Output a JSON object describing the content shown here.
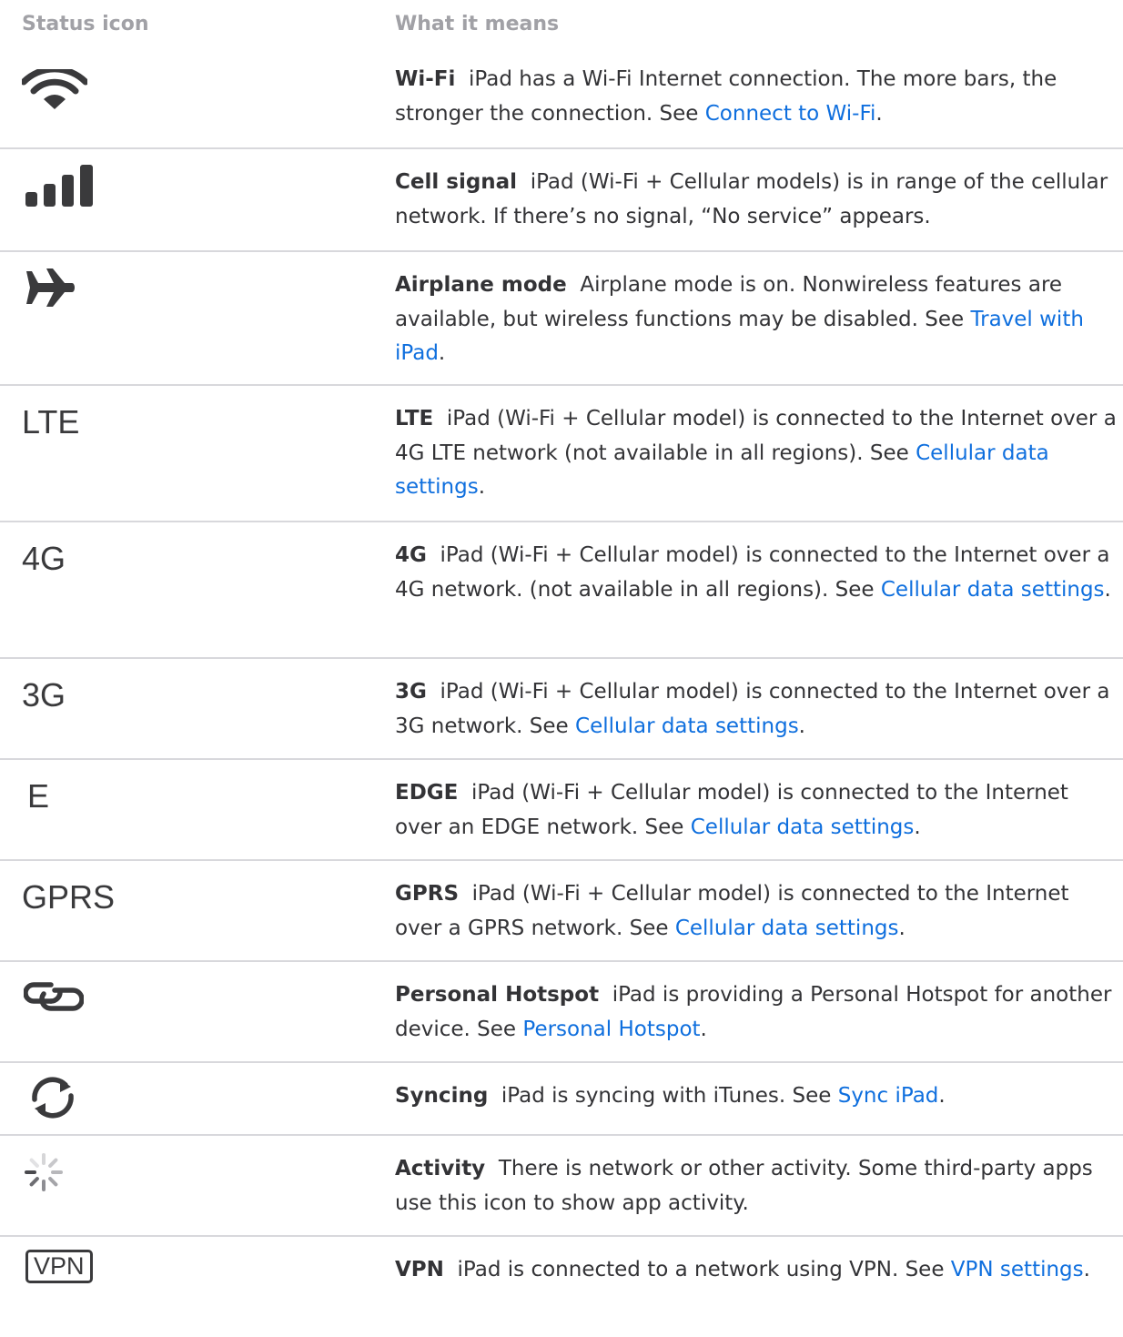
{
  "header": {
    "col_icon": "Status icon",
    "col_meaning": "What it means"
  },
  "rows": [
    {
      "icon": "wifi-icon",
      "title": "Wi-Fi",
      "text": "iPad has a Wi-Fi Internet connection. The more bars, the stronger the connection. See ",
      "link": "Connect to Wi-Fi",
      "after": "."
    },
    {
      "icon": "cell-signal-icon",
      "title": "Cell signal",
      "text": "iPad (Wi-Fi + Cellular models) is in range of the cellular network. If there’s no signal, “No service” appears.",
      "link": "",
      "after": ""
    },
    {
      "icon": "airplane-icon",
      "title": "Airplane mode",
      "text": "Airplane mode is on. Nonwireless features are available, but wireless functions may be disabled. See ",
      "link": "Travel with iPad",
      "after": "."
    },
    {
      "icon_text": "LTE",
      "title": "LTE",
      "text": "iPad (Wi-Fi + Cellular model) is connected to the Internet over a 4G LTE network (not available in all regions). See ",
      "link": "Cellular data settings",
      "after": "."
    },
    {
      "icon_text": "4G",
      "title": "4G",
      "text": "iPad (Wi-Fi + Cellular model) is connected to the Internet over a 4G network. (not available in all regions). See ",
      "link": "Cellular data settings",
      "after": "."
    },
    {
      "icon_text": "3G",
      "title": "3G",
      "text": "iPad (Wi-Fi + Cellular model) is connected to the Internet over a 3G network. See ",
      "link": "Cellular data settings",
      "after": "."
    },
    {
      "icon_text": "E",
      "title": "EDGE",
      "text": "iPad (Wi-Fi + Cellular model) is connected to the Internet over an EDGE network. See ",
      "link": "Cellular data settings",
      "after": "."
    },
    {
      "icon_text": "GPRS",
      "title": "GPRS",
      "text": "iPad (Wi-Fi + Cellular model) is connected to the Internet over a GPRS network. See ",
      "link": "Cellular data settings",
      "after": "."
    },
    {
      "icon": "personal-hotspot-icon",
      "title": "Personal Hotspot",
      "text": "iPad is providing a Personal Hotspot for another device. See ",
      "link": "Personal Hotspot",
      "after": "."
    },
    {
      "icon": "syncing-icon",
      "title": "Syncing",
      "text": "iPad is syncing with iTunes. See ",
      "link": "Sync iPad",
      "after": "."
    },
    {
      "icon": "activity-icon",
      "title": "Activity",
      "text": "There is network or other activity. Some third-party apps use this icon to show app activity.",
      "link": "",
      "after": ""
    },
    {
      "icon_text": "VPN",
      "title": "VPN",
      "text": "iPad is connected to a network using VPN. See ",
      "link": "VPN settings",
      "after": "."
    }
  ],
  "colors": {
    "link": "#0f6fde",
    "header_text": "#a1a1a6",
    "body_text": "#333336",
    "icon": "#3a3a3c",
    "divider": "#d8d8dc"
  }
}
